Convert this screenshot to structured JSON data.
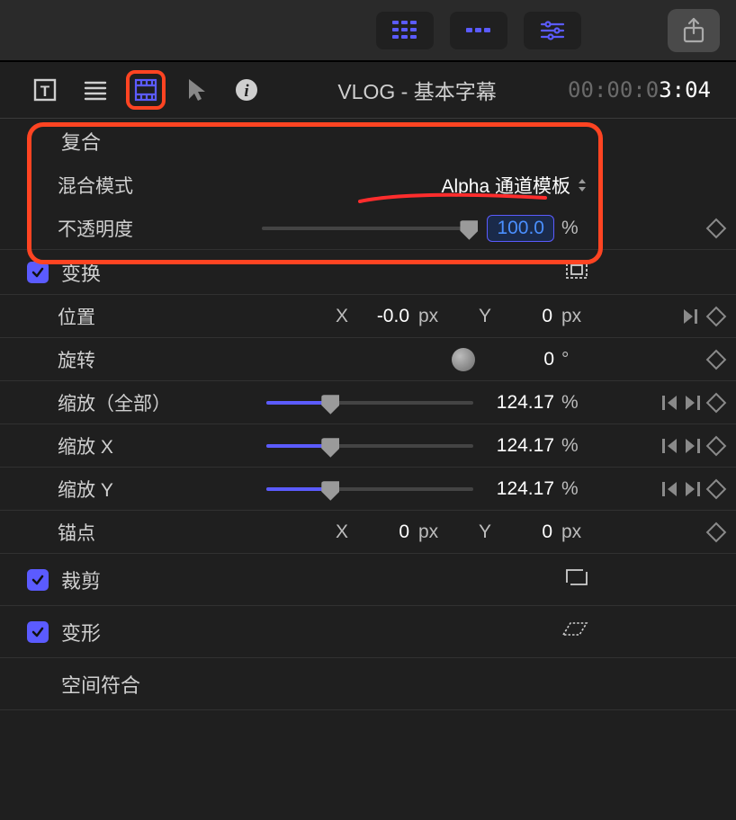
{
  "toolbar": {
    "grid_icon": "grid9",
    "strip_icon": "strip",
    "sliders_icon": "sliders",
    "share_icon": "share"
  },
  "header": {
    "title": "VLOG - 基本字幕",
    "timecode_grey": "00:00:0",
    "timecode_white": "3:04"
  },
  "composite": {
    "section_label": "复合",
    "blend_label": "混合模式",
    "blend_value": "Alpha 通道模板",
    "opacity_label": "不透明度",
    "opacity_value": "100.0",
    "opacity_unit": "%"
  },
  "transform": {
    "section_label": "变换",
    "checked": true,
    "position_label": "位置",
    "position_x": "-0.0",
    "position_y": "0",
    "rotation_label": "旋转",
    "rotation_value": "0",
    "rotation_unit": "°",
    "scale_all_label": "缩放（全部）",
    "scale_all_value": "124.17",
    "scale_x_label": "缩放 X",
    "scale_x_value": "124.17",
    "scale_y_label": "缩放 Y",
    "scale_y_value": "124.17",
    "scale_unit": "%",
    "anchor_label": "锚点",
    "anchor_x": "0",
    "anchor_y": "0",
    "px_unit": "px"
  },
  "crop": {
    "section_label": "裁剪",
    "checked": true
  },
  "distort": {
    "section_label": "变形",
    "checked": true
  },
  "spatial": {
    "section_label": "空间符合"
  },
  "labels": {
    "axis_x": "X",
    "axis_y": "Y"
  }
}
